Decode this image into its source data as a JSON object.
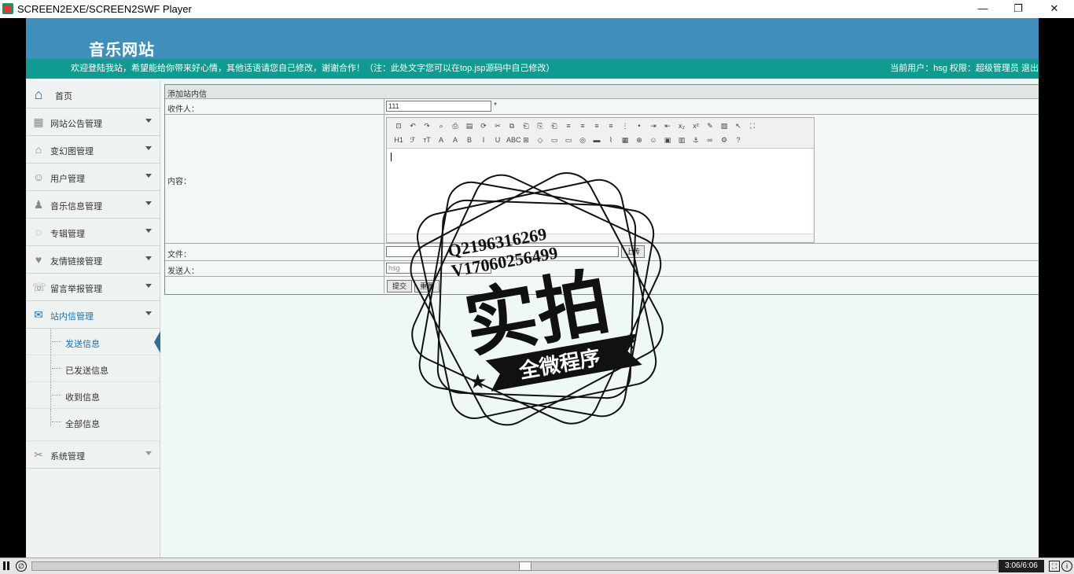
{
  "window": {
    "title": "SCREEN2EXE/SCREEN2SWF Player",
    "minimize": "—",
    "restore": "❐",
    "close": "✕"
  },
  "header": {
    "site_title": "音乐网站",
    "welcome": "欢迎登陆我站，希望能给你带来好心情，其他话语请您自己修改，谢谢合作！（注：此处文字您可以在top.jsp源码中自己修改）",
    "user_info": "当前用户：hsg 权限：超级管理员 退出"
  },
  "sidebar": {
    "items": [
      {
        "label": "首页",
        "icon": "home-icon",
        "glyph": "⌂"
      },
      {
        "label": "网站公告管理",
        "icon": "grid-icon",
        "glyph": "▦"
      },
      {
        "label": "变幻图管理",
        "icon": "house-icon",
        "glyph": "⌂"
      },
      {
        "label": "用户管理",
        "icon": "users-icon",
        "glyph": "☺"
      },
      {
        "label": "音乐信息管理",
        "icon": "person-icon",
        "glyph": "♟"
      },
      {
        "label": "专辑管理",
        "icon": "chat-icon",
        "glyph": "◌"
      },
      {
        "label": "友情链接管理",
        "icon": "heart-icon",
        "glyph": "♥"
      },
      {
        "label": "留言举报管理",
        "icon": "message-icon",
        "glyph": "☏"
      },
      {
        "label": "站内信管理",
        "icon": "mailbox-icon",
        "glyph": "✉"
      }
    ],
    "sub_items": [
      {
        "label": "发送信息"
      },
      {
        "label": "已发送信息"
      },
      {
        "label": "收到信息"
      },
      {
        "label": "全部信息"
      }
    ],
    "system": {
      "label": "系统管理",
      "icon": "tools-icon",
      "glyph": "✂"
    }
  },
  "form": {
    "heading": "添加站内信",
    "recipient_label": "收件人：",
    "recipient_value": "111",
    "required_mark": "*",
    "content_label": "内容：",
    "file_label": "文件：",
    "upload_button": "上传",
    "sender_label": "发送人：",
    "sender_value": "hsg",
    "submit_button": "提交",
    "reset_button": "重置"
  },
  "editor": {
    "row1": [
      "⊡",
      "↶",
      "↷",
      "⌕",
      "⎙",
      "▤",
      "⟳",
      "✂",
      "⧉",
      "⎗",
      "⎘",
      "⎗",
      "≡",
      "≡",
      "≡",
      "≡",
      "⋮",
      "•",
      "⇥",
      "⇤",
      "x₂",
      "x²",
      "✎",
      "▧",
      "↖",
      "⛶"
    ],
    "row2": [
      "H1",
      "ℱ",
      "тT",
      "A",
      "A",
      "B",
      "I",
      "U",
      "ABC",
      "⊞",
      "◇",
      "▭",
      "▭",
      "◎",
      "▬",
      "⌇",
      "▦",
      "⊕",
      "☺",
      "▣",
      "▥",
      "⚓",
      "∞",
      "⚙",
      "?"
    ]
  },
  "watermark": {
    "line1": "Q2196316269",
    "line2": "V17060256499",
    "big": "实拍",
    "banner": "全微程序"
  },
  "player": {
    "time": "3:06/6:06",
    "progress": 0.51
  }
}
